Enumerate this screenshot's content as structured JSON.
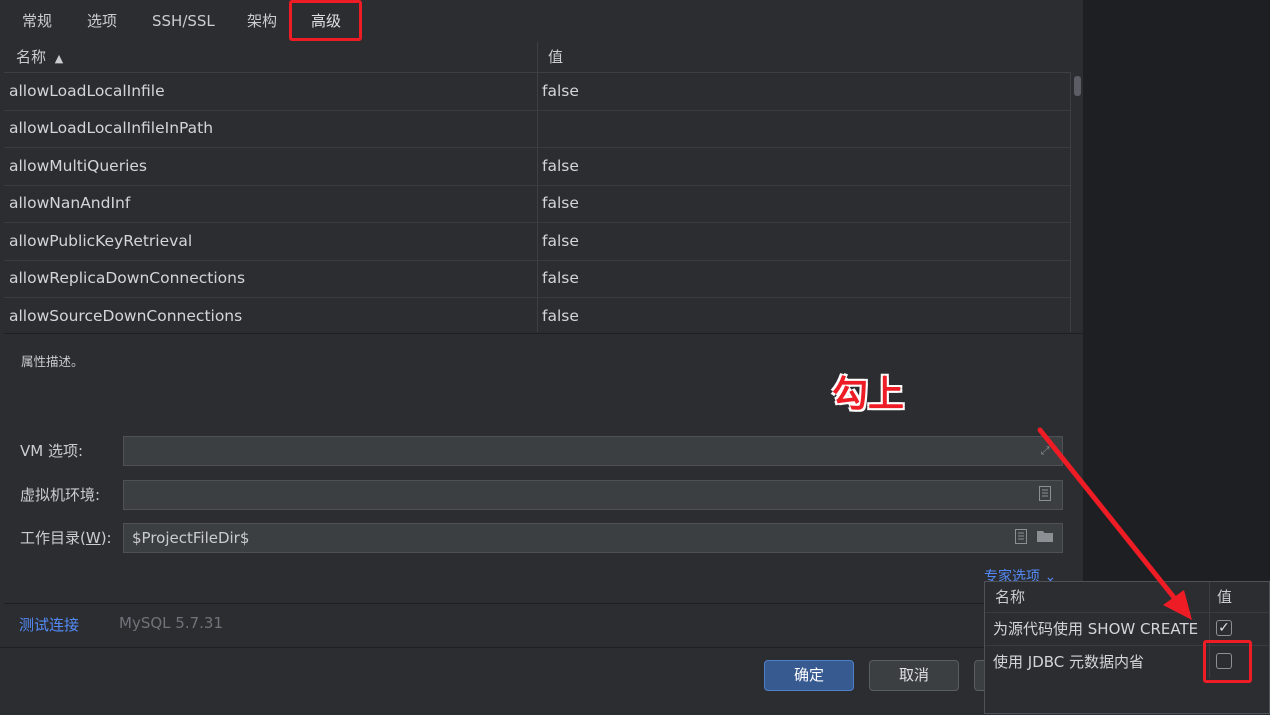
{
  "tabs": [
    "常规",
    "选项",
    "SSH/SSL",
    "架构",
    "高级"
  ],
  "table": {
    "headers": {
      "name": "名称",
      "value": "值"
    },
    "sort_indicator": "▲",
    "rows": [
      {
        "name": "allowLoadLocalInfile",
        "value": "false"
      },
      {
        "name": "allowLoadLocalInfileInPath",
        "value": ""
      },
      {
        "name": "allowMultiQueries",
        "value": "false"
      },
      {
        "name": "allowNanAndInf",
        "value": "false"
      },
      {
        "name": "allowPublicKeyRetrieval",
        "value": "false"
      },
      {
        "name": "allowReplicaDownConnections",
        "value": "false"
      },
      {
        "name": "allowSourceDownConnections",
        "value": "false"
      }
    ]
  },
  "description": "属性描述。",
  "fields": {
    "vm_label": "VM 选项:",
    "vm_value": "",
    "env_label": "虚拟机环境:",
    "env_value": "",
    "workdir_label_pre": "工作目录(",
    "workdir_mnemonic": "W",
    "workdir_label_post": "):",
    "workdir_value": "$ProjectFileDir$"
  },
  "expert_link": "专家选项",
  "footer": {
    "test_link": "测试连接",
    "db_version": "MySQL 5.7.31",
    "ok": "确定",
    "cancel": "取消"
  },
  "expert_popup": {
    "headers": {
      "name": "名称",
      "value": "值"
    },
    "rows": [
      {
        "name": "为源代码使用 SHOW CREATE",
        "checked": true,
        "mark": "✓"
      },
      {
        "name": "使用 JDBC 元数据内省",
        "checked": false,
        "mark": ""
      }
    ]
  },
  "annotation": {
    "text": "勾上",
    "color": "#ee1c25"
  },
  "colors": {
    "accent": "#548af7",
    "highlight": "#ee1c25",
    "primary_button": "#375a91"
  }
}
